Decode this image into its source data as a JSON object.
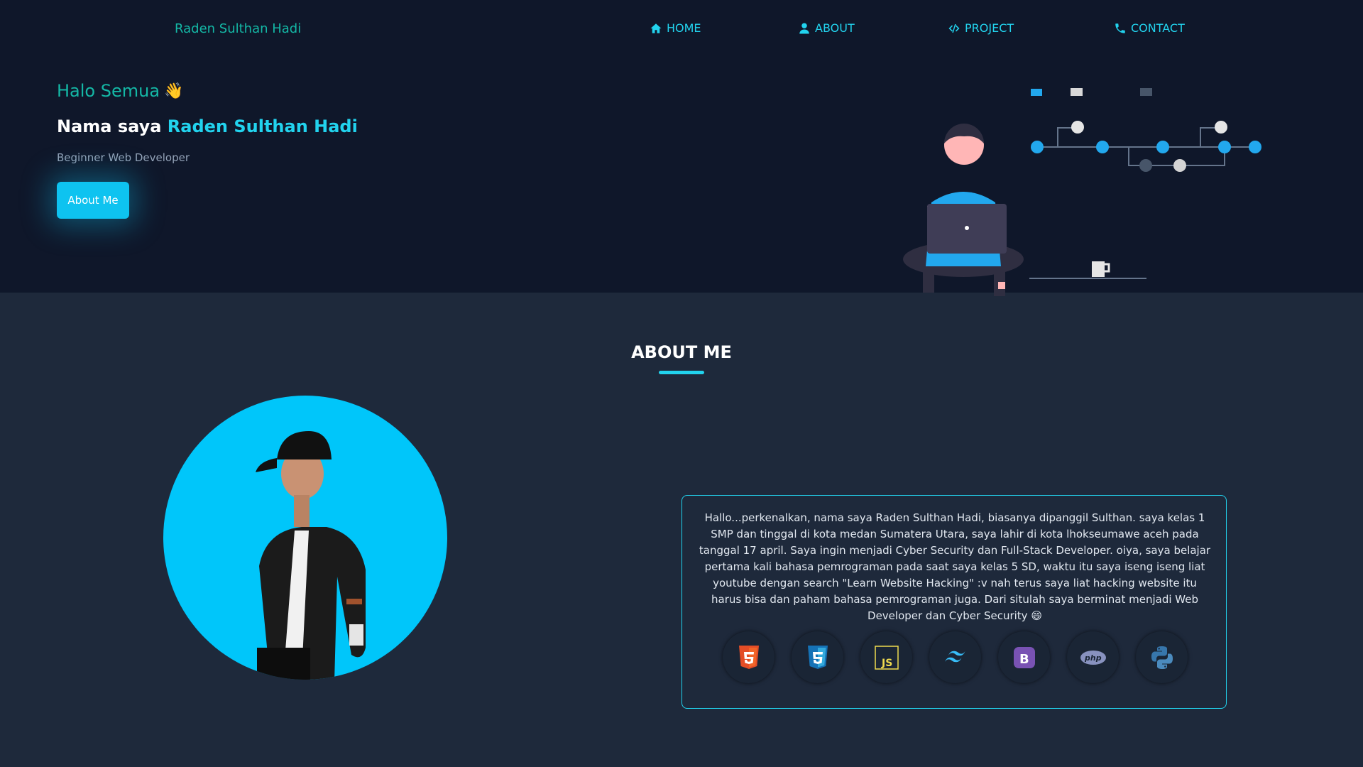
{
  "header": {
    "brand": "Raden Sulthan Hadi",
    "nav": [
      {
        "label": "HOME",
        "icon": "home-icon"
      },
      {
        "label": "ABOUT",
        "icon": "user-icon"
      },
      {
        "label": "PROJECT",
        "icon": "code-icon"
      },
      {
        "label": "CONTACT",
        "icon": "phone-icon"
      }
    ]
  },
  "hero": {
    "greeting": "Halo Semua",
    "greeting_emoji": "👋",
    "name_prefix": "Nama saya",
    "name_highlight": "Raden Sulthan Hadi",
    "role": "Beginner Web Developer",
    "button_label": "About Me"
  },
  "about": {
    "title": "ABOUT ME",
    "text": "Hallo...perkenalkan, nama saya Raden Sulthan Hadi, biasanya dipanggil Sulthan. saya kelas 1 SMP dan tinggal di kota medan Sumatera Utara, saya lahir di kota lhokseumawe aceh pada tanggal 17 april. Saya ingin menjadi Cyber Security dan Full-Stack Developer. oiya, saya belajar pertama kali bahasa pemrograman pada saat saya kelas 5 SD, waktu itu saya iseng iseng liat youtube dengan search \"Learn Website Hacking\" :v nah terus saya liat hacking website itu harus bisa dan paham bahasa pemrograman juga. Dari situlah saya berminat menjadi Web Developer dan Cyber Security 😄",
    "tech_icons": [
      "html5-icon",
      "css3-icon",
      "javascript-icon",
      "tailwind-icon",
      "bootstrap-icon",
      "php-icon",
      "python-icon"
    ]
  },
  "colors": {
    "accent": "#22d3ee",
    "teal": "#14b8a6",
    "hero_bg": "#0f172a",
    "page_bg": "#1e293b",
    "avatar_bg": "#00c6fa"
  }
}
